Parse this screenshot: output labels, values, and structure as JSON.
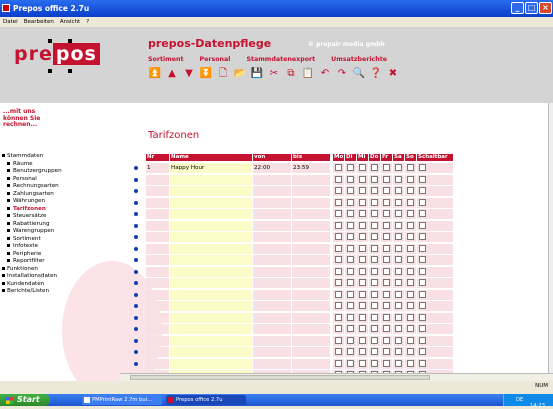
{
  "window": {
    "title": "Prepos office 2.7u"
  },
  "menubar": [
    "Datei",
    "Bearbeiten",
    "Ansicht",
    "?"
  ],
  "logo": {
    "pre": "pre",
    "pos": "pos"
  },
  "header": {
    "title": "prepos-Datenpflege",
    "company": "© prepair media gmbh",
    "menu": [
      "Sortiment",
      "Personal",
      "Stammdatenexport",
      "Umsatzberichte"
    ]
  },
  "toolbar": [
    {
      "icon": "first-record-icon",
      "glyph": "⏫"
    },
    {
      "icon": "up-icon",
      "glyph": "▲"
    },
    {
      "icon": "down-icon",
      "glyph": "▼"
    },
    {
      "icon": "last-record-icon",
      "glyph": "⏬"
    },
    {
      "icon": "new-icon",
      "glyph": "🗋"
    },
    {
      "icon": "open-icon",
      "glyph": "📂"
    },
    {
      "icon": "save-icon",
      "glyph": "💾"
    },
    {
      "icon": "cut-icon",
      "glyph": "✂"
    },
    {
      "icon": "copy-icon",
      "glyph": "⧉"
    },
    {
      "icon": "paste-icon",
      "glyph": "📋"
    },
    {
      "icon": "undo-icon",
      "glyph": "↶"
    },
    {
      "icon": "redo-icon",
      "glyph": "↷"
    },
    {
      "icon": "search-icon",
      "glyph": "🔍"
    },
    {
      "icon": "help-icon",
      "glyph": "❓"
    },
    {
      "icon": "close-icon",
      "glyph": "✖"
    }
  ],
  "sidebar": {
    "tagline": [
      "...mit uns",
      "können Sie",
      "rechnen..."
    ],
    "tree": [
      {
        "label": "Stammdaten",
        "level": 0
      },
      {
        "label": "Räume",
        "level": 1
      },
      {
        "label": "Benutzergruppen",
        "level": 1
      },
      {
        "label": "Personal",
        "level": 1
      },
      {
        "label": "Rechnungsarten",
        "level": 1
      },
      {
        "label": "Zahlungsarten",
        "level": 1
      },
      {
        "label": "Währungen",
        "level": 1
      },
      {
        "label": "Tarifzonen",
        "level": 1,
        "active": true
      },
      {
        "label": "Steuersätze",
        "level": 1
      },
      {
        "label": "Rabattierung",
        "level": 1
      },
      {
        "label": "Warengruppen",
        "level": 1
      },
      {
        "label": "Sortiment",
        "level": 1
      },
      {
        "label": "Infotexte",
        "level": 1
      },
      {
        "label": "Peripherie",
        "level": 1
      },
      {
        "label": "Reportfilter",
        "level": 1
      },
      {
        "label": "Funktionen",
        "level": 0
      },
      {
        "label": "Installationsdaten",
        "level": 0
      },
      {
        "label": "Kundendaten",
        "level": 0
      },
      {
        "label": "Berichte/Listen",
        "level": 0
      }
    ]
  },
  "page": {
    "title": "Tarifzonen"
  },
  "table": {
    "columns": [
      "Nr",
      "Name",
      "von",
      "bis",
      "Mo",
      "Di",
      "Mi",
      "Do",
      "Fr",
      "Sa",
      "So",
      "Schaltbar"
    ],
    "rows": [
      {
        "nr": "1",
        "name": "Happy Hour",
        "von": "22:00",
        "bis": "23:59"
      },
      {
        "nr": "",
        "name": "",
        "von": "",
        "bis": ""
      },
      {
        "nr": "",
        "name": "",
        "von": "",
        "bis": ""
      },
      {
        "nr": "",
        "name": "",
        "von": "",
        "bis": ""
      },
      {
        "nr": "",
        "name": "",
        "von": "",
        "bis": ""
      },
      {
        "nr": "",
        "name": "",
        "von": "",
        "bis": ""
      },
      {
        "nr": "",
        "name": "",
        "von": "",
        "bis": ""
      },
      {
        "nr": "",
        "name": "",
        "von": "",
        "bis": ""
      },
      {
        "nr": "",
        "name": "",
        "von": "",
        "bis": ""
      },
      {
        "nr": "",
        "name": "",
        "von": "",
        "bis": ""
      },
      {
        "nr": "",
        "name": "",
        "von": "",
        "bis": ""
      },
      {
        "nr": "",
        "name": "",
        "von": "",
        "bis": ""
      },
      {
        "nr": "",
        "name": "",
        "von": "",
        "bis": ""
      },
      {
        "nr": "",
        "name": "",
        "von": "",
        "bis": ""
      },
      {
        "nr": "",
        "name": "",
        "von": "",
        "bis": ""
      },
      {
        "nr": "",
        "name": "",
        "von": "",
        "bis": ""
      },
      {
        "nr": "",
        "name": "",
        "von": "",
        "bis": ""
      },
      {
        "nr": "",
        "name": "",
        "von": "",
        "bis": ""
      },
      {
        "nr": "",
        "name": "",
        "von": "",
        "bis": ""
      }
    ]
  },
  "status": {
    "zoom": "NUM"
  },
  "taskbar": {
    "start": "Start",
    "tasks": [
      "PMPrintRaw 2.7m bui...",
      "Prepos office 2.7u"
    ],
    "tray": {
      "lang": "DE",
      "time": "14:23"
    }
  },
  "colors": {
    "brand": "#c41230",
    "header_bg": "#d4d4d4",
    "row_pink": "#f8e0e4",
    "row_yellow": "#fcfcc8"
  }
}
